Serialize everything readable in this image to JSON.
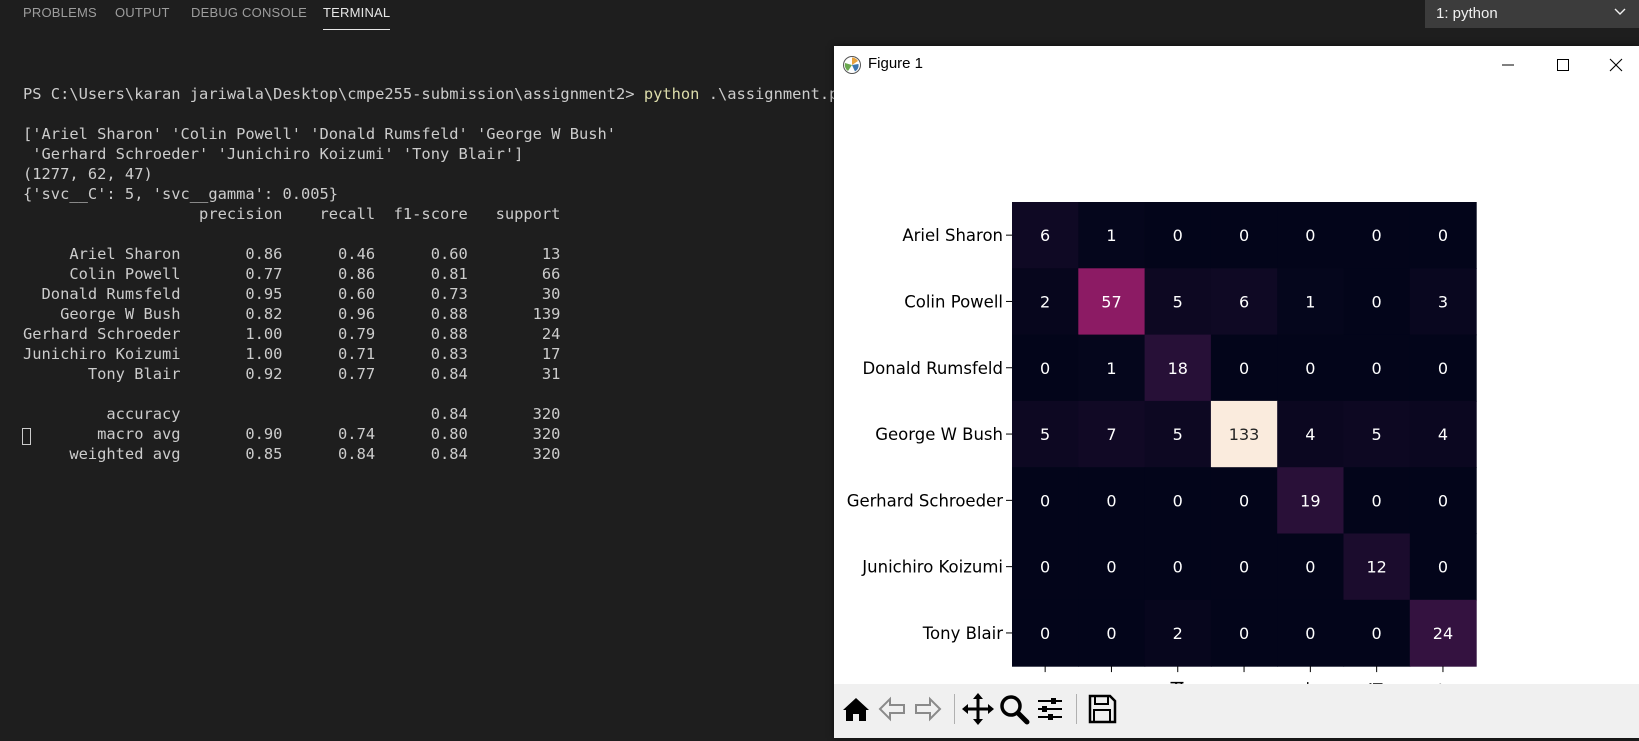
{
  "panel": {
    "tabs": [
      "PROBLEMS",
      "OUTPUT",
      "DEBUG CONSOLE",
      "TERMINAL"
    ],
    "active_tab": "TERMINAL",
    "terminal_selector": "1: python"
  },
  "terminal": {
    "prompt": "PS C:\\Users\\karan jariwala\\Desktop\\cmpe255-submission\\assignment2> ",
    "command": "python",
    "command_arg": " .\\assignment.py",
    "output_lines": [
      "['Ariel Sharon' 'Colin Powell' 'Donald Rumsfeld' 'George W Bush'",
      " 'Gerhard Schroeder' 'Junichiro Koizumi' 'Tony Blair']",
      "(1277, 62, 47)",
      "{'svc__C': 5, 'svc__gamma': 0.005}",
      "                   precision    recall  f1-score   support",
      "",
      "     Ariel Sharon       0.86      0.46      0.60        13",
      "     Colin Powell       0.77      0.86      0.81        66",
      "  Donald Rumsfeld       0.95      0.60      0.73        30",
      "    George W Bush       0.82      0.96      0.88       139",
      "Gerhard Schroeder       1.00      0.79      0.88        24",
      "Junichiro Koizumi       1.00      0.71      0.83        17",
      "       Tony Blair       0.92      0.77      0.84        31",
      "",
      "         accuracy                           0.84       320",
      "        macro avg       0.90      0.74      0.80       320",
      "     weighted avg       0.85      0.84      0.84       320"
    ]
  },
  "figure": {
    "title": "Figure 1",
    "toolbar_icons": [
      "home-icon",
      "back-arrow-icon",
      "forward-arrow-icon",
      "pan-icon",
      "zoom-icon",
      "configure-subplots-icon",
      "save-icon"
    ]
  },
  "chart_data": {
    "type": "heatmap",
    "row_labels": [
      "Ariel Sharon",
      "Colin Powell",
      "Donald Rumsfeld",
      "George W Bush",
      "Gerhard Schroeder",
      "Junichiro Koizumi",
      "Tony Blair"
    ],
    "col_labels_visible": [
      "haron",
      "Powell",
      "msfeld",
      "/ Bush",
      "roeder",
      "oizumi",
      "y Blair"
    ],
    "values": [
      [
        6,
        1,
        0,
        0,
        0,
        0,
        0
      ],
      [
        2,
        57,
        5,
        6,
        1,
        0,
        3
      ],
      [
        0,
        1,
        18,
        0,
        0,
        0,
        0
      ],
      [
        5,
        7,
        5,
        133,
        4,
        5,
        4
      ],
      [
        0,
        0,
        0,
        0,
        19,
        0,
        0
      ],
      [
        0,
        0,
        0,
        0,
        0,
        12,
        0
      ],
      [
        0,
        0,
        2,
        0,
        0,
        0,
        24
      ]
    ],
    "vmin": 0,
    "vmax": 133,
    "colormap": "rocket",
    "colorbar": false
  }
}
